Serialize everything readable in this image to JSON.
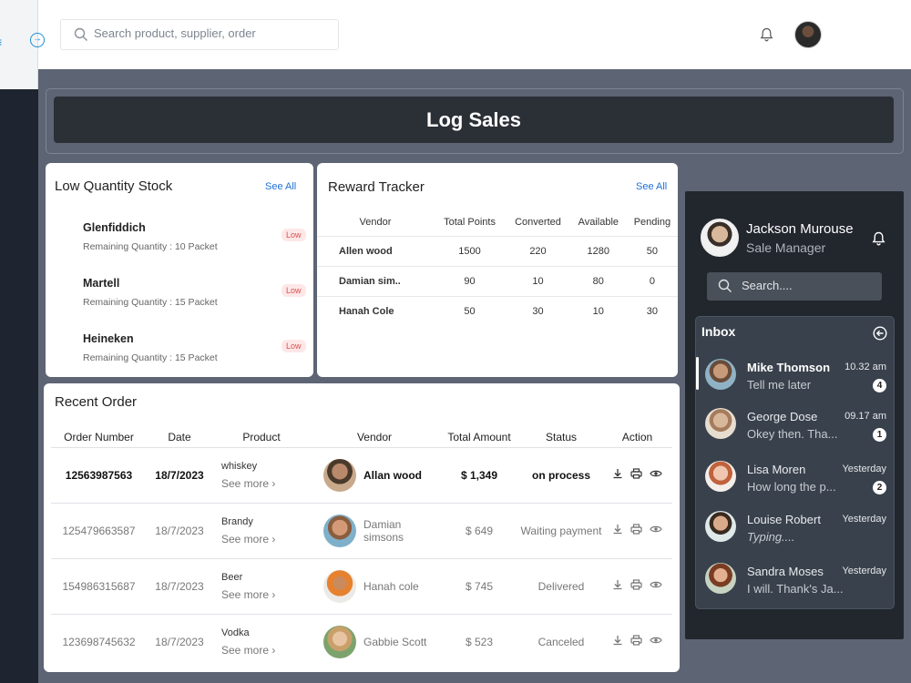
{
  "topbar": {
    "search_placeholder": "Search product, supplier, order"
  },
  "banner": {
    "title": "Log Sales"
  },
  "low_stock": {
    "title": "Low Quantity  Stock",
    "see_all": "See All",
    "items": [
      {
        "name": "Glenfiddich",
        "qty": "Remaining Quantity : 10 Packet",
        "badge": "Low"
      },
      {
        "name": "Martell",
        "qty": "Remaining Quantity : 15 Packet",
        "badge": "Low"
      },
      {
        "name": "Heineken",
        "qty": "Remaining Quantity : 15 Packet",
        "badge": "Low"
      }
    ]
  },
  "reward": {
    "title": "Reward Tracker",
    "see_all": "See All",
    "headers": [
      "Vendor",
      "Total Points",
      "Converted",
      "Available",
      "Pending"
    ],
    "rows": [
      [
        "Allen wood",
        "1500",
        "220",
        "1280",
        "50"
      ],
      [
        "Damian sim..",
        "90",
        "10",
        "80",
        "0"
      ],
      [
        "Hanah Cole",
        "50",
        "30",
        "10",
        "30"
      ]
    ]
  },
  "recent": {
    "title": "Recent Order",
    "headers": [
      "Order Number",
      "Date",
      "Product",
      "Vendor",
      "Total Amount",
      "Status",
      "Action"
    ],
    "see_more": "See more",
    "rows": [
      {
        "order": "12563987563",
        "date": "18/7/2023",
        "product": "whiskey",
        "vendor": "Allan wood",
        "amount": "$ 1,349",
        "status": "on process"
      },
      {
        "order": "125479663587",
        "date": "18/7/2023",
        "product": "Brandy",
        "vendor": "Damian simsons",
        "amount": "$ 649",
        "status": "Waiting payment"
      },
      {
        "order": "154986315687",
        "date": "18/7/2023",
        "product": "Beer",
        "vendor": "Hanah cole",
        "amount": "$ 745",
        "status": "Delivered"
      },
      {
        "order": "123698745632",
        "date": "18/7/2023",
        "product": "Vodka",
        "vendor": "Gabbie Scott",
        "amount": "$ 523",
        "status": "Canceled"
      }
    ]
  },
  "profile": {
    "name": "Jackson Murouse",
    "role": "Sale Manager",
    "search_placeholder": "Search...."
  },
  "inbox": {
    "title": "Inbox",
    "messages": [
      {
        "name": "Mike Thomson",
        "text": "Tell me later",
        "time": "10.32 am",
        "badge": "4"
      },
      {
        "name": "George Dose",
        "text": "Okey then. Tha...",
        "time": "09.17 am",
        "badge": "1"
      },
      {
        "name": "Lisa Moren",
        "text": "How long the p...",
        "time": "Yesterday",
        "badge": "2"
      },
      {
        "name": "Louise Robert",
        "text": "Typing....",
        "time": "Yesterday",
        "badge": ""
      },
      {
        "name": "Sandra Moses",
        "text": "I will. Thank's Ja...",
        "time": "Yesterday",
        "badge": ""
      }
    ]
  }
}
